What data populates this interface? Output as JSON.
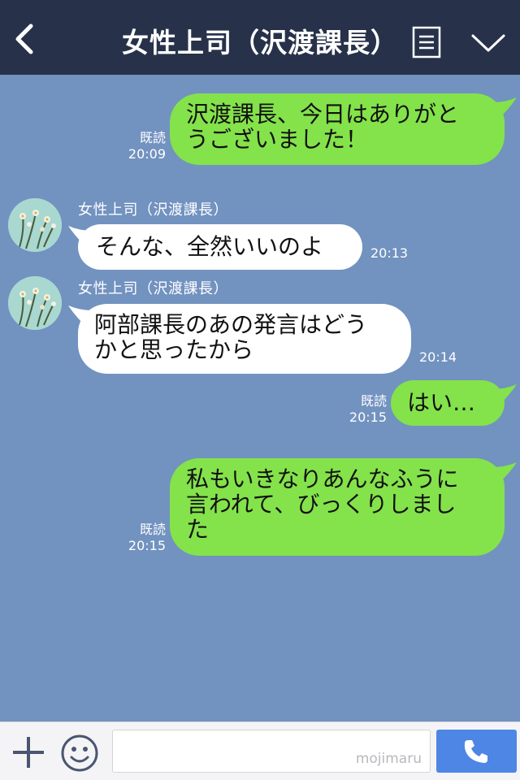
{
  "header": {
    "title": "女性上司（沢渡課長）",
    "icons": [
      "back-icon",
      "menu-icon",
      "chevron-down-icon"
    ],
    "bg_color": "#27324a"
  },
  "chat": {
    "bg_color": "#7292c0",
    "outgoing_color": "#84e24b",
    "incoming_color": "#ffffff",
    "messages": [
      {
        "direction": "out",
        "lines": [
          "沢渡課長、今日はありがと",
          "うございました！"
        ],
        "read": "既読",
        "time": "20:09"
      },
      {
        "direction": "in",
        "sender": "女性上司（沢渡課長）",
        "lines": [
          "そんな、全然いいのよ"
        ],
        "time": "20:13"
      },
      {
        "direction": "in",
        "sender": "女性上司（沢渡課長）",
        "lines": [
          "阿部課長のあの発言はどう",
          "かと思ったから"
        ],
        "time": "20:14"
      },
      {
        "direction": "out",
        "lines": [
          "はい…"
        ],
        "read": "既読",
        "time": "20:15"
      },
      {
        "direction": "out",
        "lines": [
          "私もいきなりあんなふうに",
          "言われて、びっくりしまし",
          "た"
        ],
        "read": "既読",
        "time": "20:15"
      }
    ]
  },
  "footer": {
    "input_value": "",
    "watermark": "mojimaru",
    "icons": [
      "plus-icon",
      "emoji-icon",
      "phone-icon"
    ],
    "send_color": "#4d86e4"
  }
}
